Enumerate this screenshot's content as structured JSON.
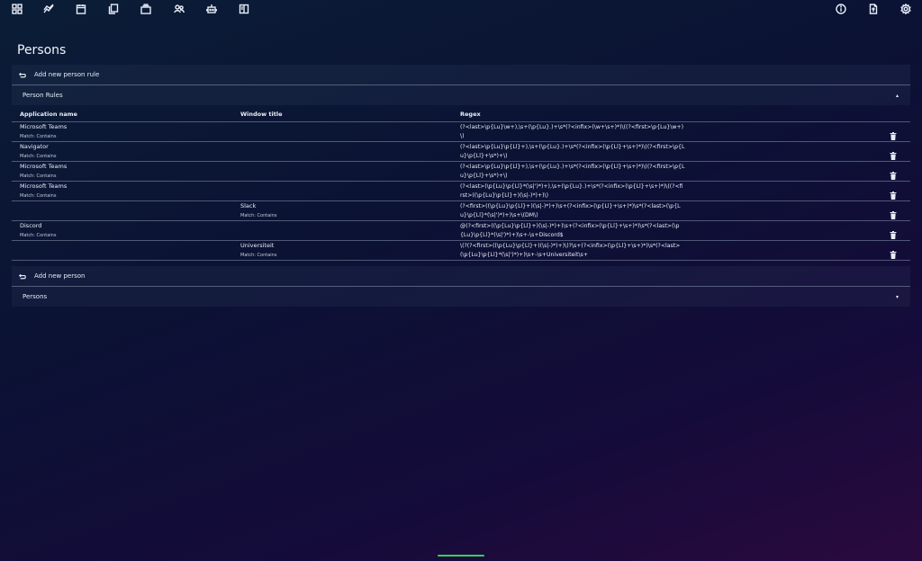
{
  "topbar": {
    "left_icons": [
      "dashboard-icon",
      "chart-icon",
      "calendar-icon",
      "documents-icon",
      "layers-icon",
      "people-icon",
      "robot-icon",
      "panels-icon"
    ],
    "right_icons": [
      "info-icon",
      "export-file-icon",
      "settings-icon"
    ]
  },
  "page": {
    "title": "Persons"
  },
  "rule_add": {
    "label": "Add new person rule"
  },
  "rules_section": {
    "label": "Person Rules",
    "chevron": "▴"
  },
  "rules_table": {
    "headers": {
      "app": "Application name",
      "window": "Window title",
      "regex": "Regex"
    },
    "rows": [
      {
        "app": "Microsoft Teams",
        "app_match": "Match: Contains",
        "window": "",
        "window_match": "",
        "regex": "(?<last>\\p{Lu}\\w+),\\s+(\\p{Lu}.)+\\s*(?<infix>(\\w+\\s+)*)\\((?<first>\\p{Lu}\\w+)\\)"
      },
      {
        "app": "Navigator",
        "app_match": "Match: Contains",
        "window": "",
        "window_match": "",
        "regex": "(?<last>\\p{Lu}\\p{Ll}+),\\s+(\\p{Lu}.)+\\s*(?<infix>(\\p{Ll}+\\s+)*)\\((?<first>\\p{Lu}\\p{Ll}+\\s*)+\\)"
      },
      {
        "app": "Microsoft Teams",
        "app_match": "Match: Contains",
        "window": "",
        "window_match": "",
        "regex": "(?<last>\\p{Lu}\\p{Ll}+),\\s+(\\p{Lu}.)+\\s*(?<infix>(\\p{Ll}+\\s+)*)\\((?<first>\\p{Lu}\\p{Ll}+\\s*)+\\)"
      },
      {
        "app": "Microsoft Teams",
        "app_match": "Match: Contains",
        "window": "",
        "window_match": "",
        "regex": "(?<last>(\\p{Lu}\\p{Ll}*(\\s|')*)+),\\s+(\\p{Lu}.)+\\s*(?<infix>(\\p{Ll}+\\s+)*)\\((?<first>((\\p{Lu}\\p{Ll}+)(\\s|-)*)+)\\)"
      },
      {
        "app": "",
        "app_match": "",
        "window": "Slack",
        "window_match": "Match: Contains",
        "regex": "(?<first>((\\p{Lu}\\p{Ll}+)(\\s|-)*)+)\\s+(?<infix>(\\p{Ll}+\\s+)*)\\s*(?<last>(\\p{Lu}\\p{Ll}*(\\s|')*)+)\\s+\\(DM\\)"
      },
      {
        "app": "Discord",
        "app_match": "Match: Contains",
        "window": "",
        "window_match": "",
        "regex": "@(?<first>((\\p{Lu}\\p{Ll}+)(\\s|-)*)+)\\s+(?<infix>(\\p{Ll}+\\s+)*)\\s*(?<last>(\\p{Lu}\\p{Ll}*(\\s|')*)+)\\s+-\\s+Discord$"
      },
      {
        "app": "",
        "app_match": "",
        "window": "Universiteit",
        "window_match": "Match: Contains",
        "regex": "\\(?(?<first>((\\p{Lu}\\p{Ll}+)(\\s|-)*)+)\\)?\\s+(?<infix>(\\p{Ll}+\\s+)*)\\s*(?<last>(\\p{Lu}\\p{Ll}*(\\s|')*)+)\\s+-\\s+Universiteit\\s+"
      }
    ]
  },
  "person_add": {
    "label": "Add new person"
  },
  "persons_section": {
    "label": "Persons",
    "chevron": "▾"
  },
  "colors": {
    "accent": "#2fd45a",
    "bg_start": "#0b1d36",
    "bg_end": "#2b0a3e"
  }
}
